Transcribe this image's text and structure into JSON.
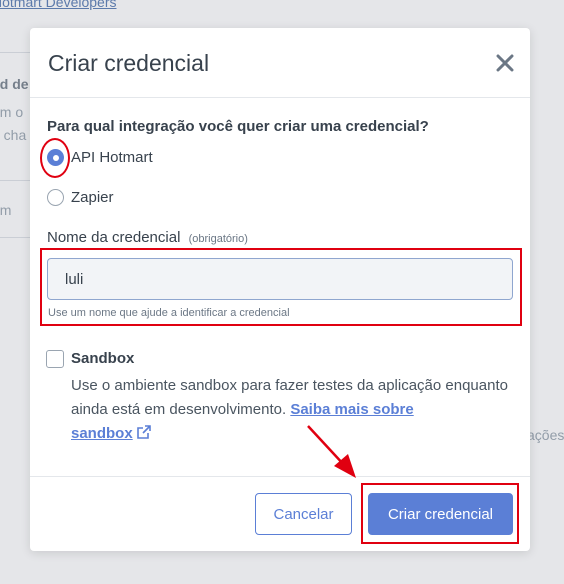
{
  "background": {
    "top_link": "Hotmart Developers",
    "fragments": [
      "ad de",
      "em o",
      "a cha",
      "om",
      "ações"
    ]
  },
  "modal": {
    "title": "Criar credencial",
    "close_icon": "close-icon",
    "question": "Para qual integração você quer criar uma credencial?",
    "integration_options": [
      {
        "label": "API Hotmart",
        "selected": true
      },
      {
        "label": "Zapier",
        "selected": false
      }
    ],
    "name_field": {
      "label": "Nome da credencial",
      "required_hint": "(obrigatório)",
      "value": "luli",
      "helper": "Use um nome que ajude a identificar a credencial"
    },
    "sandbox": {
      "title": "Sandbox",
      "checked": false,
      "description": "Use o ambiente sandbox para fazer testes da aplicação enquanto ainda está em desenvolvimento.",
      "link_text_1": "Saiba mais sobre",
      "link_text_2": "sandbox",
      "link_icon": "external-link-icon"
    },
    "footer": {
      "cancel_label": "Cancelar",
      "submit_label": "Criar credencial"
    }
  },
  "colors": {
    "accent": "#5b7fd6",
    "annotation_red": "#e00010",
    "text": "#38424d"
  }
}
